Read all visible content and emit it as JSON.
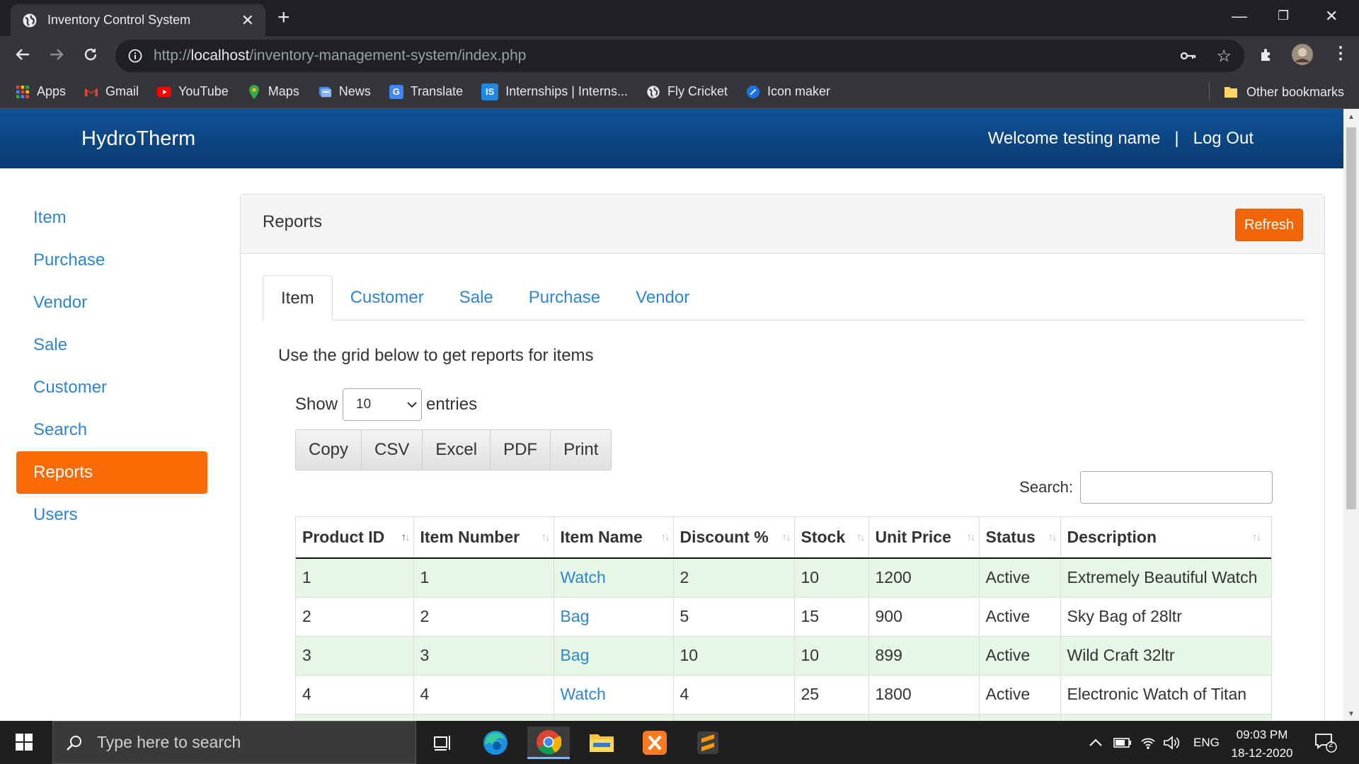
{
  "browser": {
    "tab_title": "Inventory Control System",
    "tab_icon": "globe-icon",
    "url_prefix": "http://",
    "url_host": "localhost",
    "url_path": "/inventory-management-system/index.php",
    "bookmarks": [
      {
        "label": "Apps",
        "icon": "apps-grid-icon",
        "color": "#e94235"
      },
      {
        "label": "Gmail",
        "icon": "gmail-icon",
        "color": "#ea4335"
      },
      {
        "label": "YouTube",
        "icon": "youtube-icon",
        "color": "#ff0000"
      },
      {
        "label": "Maps",
        "icon": "maps-pin-icon",
        "color": "#34a853"
      },
      {
        "label": "News",
        "icon": "news-icon",
        "color": "#4285f4"
      },
      {
        "label": "Translate",
        "icon": "translate-icon",
        "color": "#4285f4"
      },
      {
        "label": "Internships | Interns...",
        "icon": "internshala-icon",
        "color": "#1e88e5"
      },
      {
        "label": "Fly Cricket",
        "icon": "globe-icon",
        "color": "#e8eaed"
      },
      {
        "label": "Icon maker",
        "icon": "icon-maker-icon",
        "color": "#1a73e8"
      }
    ],
    "other_bookmarks": "Other bookmarks"
  },
  "app": {
    "brand": "HydroTherm",
    "welcome": "Welcome testing name",
    "separator": "|",
    "logout": "Log Out",
    "accent": "#f96b06",
    "nav_color": "#0e5298"
  },
  "sidebar": {
    "items": [
      {
        "label": "Item"
      },
      {
        "label": "Purchase"
      },
      {
        "label": "Vendor"
      },
      {
        "label": "Sale"
      },
      {
        "label": "Customer"
      },
      {
        "label": "Search"
      },
      {
        "label": "Reports"
      },
      {
        "label": "Users"
      }
    ],
    "active": "Reports"
  },
  "panel": {
    "title": "Reports",
    "refresh": "Refresh",
    "tabs": [
      "Item",
      "Customer",
      "Sale",
      "Purchase",
      "Vendor"
    ],
    "active_tab": "Item",
    "intro": "Use the grid below to get reports for items",
    "show_label": "Show",
    "entries_value": "10",
    "entries_label": "entries",
    "export_buttons": [
      "Copy",
      "CSV",
      "Excel",
      "PDF",
      "Print"
    ],
    "search_label": "Search:",
    "search_value": ""
  },
  "table": {
    "columns": [
      "Product ID",
      "Item Number",
      "Item Name",
      "Discount %",
      "Stock",
      "Unit Price",
      "Status",
      "Description"
    ],
    "rows": [
      [
        "1",
        "1",
        "Watch",
        "2",
        "10",
        "1200",
        "Active",
        "Extremely Beautiful Watch"
      ],
      [
        "2",
        "2",
        "Bag",
        "5",
        "15",
        "900",
        "Active",
        "Sky Bag of 28ltr"
      ],
      [
        "3",
        "3",
        "Bag",
        "10",
        "10",
        "899",
        "Active",
        "Wild Craft 32ltr"
      ],
      [
        "4",
        "4",
        "Watch",
        "4",
        "25",
        "1800",
        "Active",
        "Electronic Watch of Titan"
      ]
    ]
  },
  "taskbar": {
    "search_placeholder": "Type here to search",
    "language": "ENG",
    "time": "09:03 PM",
    "date": "18-12-2020",
    "notifications": "2"
  }
}
